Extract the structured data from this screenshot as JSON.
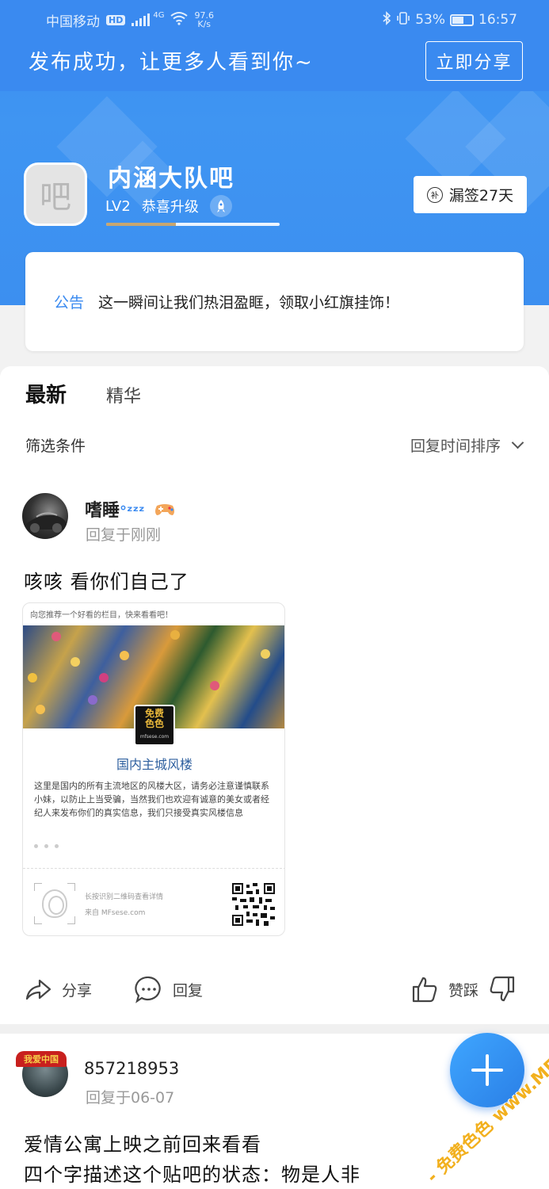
{
  "status_bar": {
    "carrier": "中国移动",
    "hd": "HD",
    "net_type": "4G",
    "speed": "97.6",
    "speed_unit": "K/s",
    "battery": "53%",
    "time": "16:57"
  },
  "header": {
    "publish_message": "发布成功，让更多人看到你~",
    "share_label": "立即分享"
  },
  "bar": {
    "avatar_char": "吧",
    "name": "内涵大队吧",
    "level": "LV2",
    "level_text": "恭喜升级",
    "progress": 0.4,
    "sign_icon_char": "补",
    "sign_label": "漏签27天"
  },
  "notice": {
    "tag": "公告",
    "text": "这一瞬间让我们热泪盈眶，领取小红旗挂饰！"
  },
  "feed": {
    "tabs": [
      "最新",
      "精华"
    ],
    "filter_label": "筛选条件",
    "sort_label": "回复时间排序"
  },
  "post1": {
    "username": "嗜睡",
    "username_suffix": "°ᶻᶻᶻ",
    "time": "回复于刚刚",
    "text": "咳咳 看你们自己了",
    "card": {
      "header": "向您推荐一个好看的栏目，快来看看吧！",
      "logo_line1": "免费",
      "logo_line2": "色色",
      "logo_site": "mfsese.com",
      "title": "国内主城风楼",
      "desc": "这里是国内的所有主流地区的风楼大区，请务必注意谨慎联系小妹，以防止上当受骗，当然我们也欢迎有诚意的美女或者经纪人来发布你们的真实信息，我们只接受真实风楼信息",
      "foot_line1": "长按识别二维码查看详情",
      "foot_line2": "来自 MFsese.com"
    },
    "actions": {
      "share": "分享",
      "reply": "回复",
      "like_dislike": "赞踩"
    }
  },
  "post2": {
    "username": "857218953",
    "avatar_badge": "我爱中国",
    "time": "回复于06-07",
    "line1": "爱情公寓上映之前回来看看",
    "line2": "四个字描述这个贴吧的状态：物是人非"
  },
  "watermark": "- 免费色色 www.MFsese.com"
}
